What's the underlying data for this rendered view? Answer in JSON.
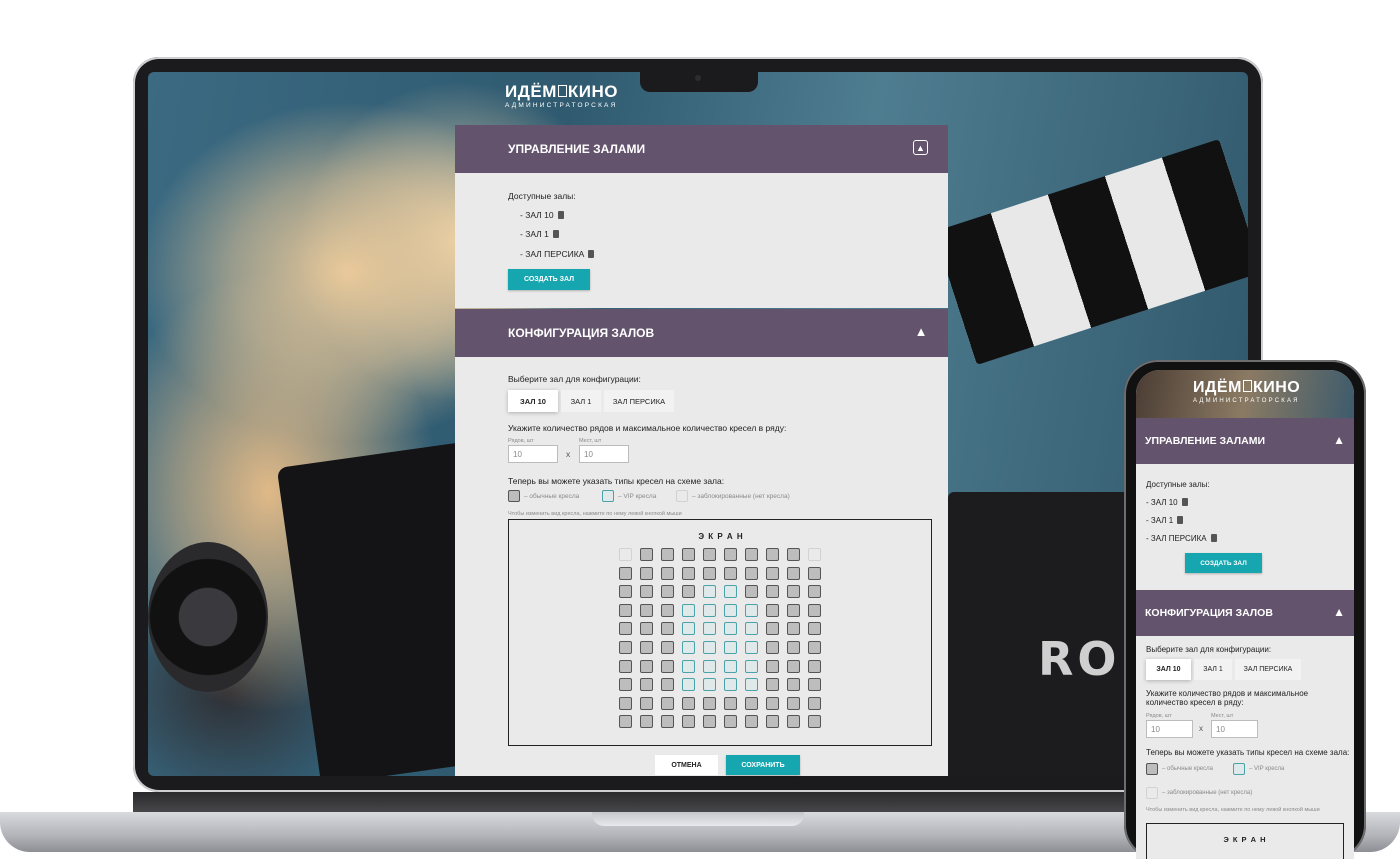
{
  "brand": {
    "title_left": "ИДЁМ",
    "title_right": "КИНО",
    "subtitle": "АДМИНИСТРАТОРСКАЯ"
  },
  "halls_panel": {
    "title": "Управление залами",
    "available_label": "Доступные залы:",
    "halls": [
      "- ЗАЛ 10",
      "- ЗАЛ 1",
      "- ЗАЛ ПЕРСИКА"
    ],
    "create_button": "СОЗДАТЬ ЗАЛ"
  },
  "config_panel": {
    "title": "Конфигурация залов",
    "select_label": "Выберите зал для конфигурации:",
    "tabs": [
      "ЗАЛ 10",
      "ЗАЛ 1",
      "ЗАЛ ПЕРСИКА"
    ],
    "active_tab": "ЗАЛ 10",
    "rows_prompt": "Укажите количество рядов и максимальное количество кресел в ряду:",
    "rows_label": "Рядов, шт",
    "rows_value": "10",
    "seats_label": "Мест, шт",
    "seats_value": "10",
    "times": "x",
    "types_prompt": "Теперь вы можете указать типы кресел на схеме зала:",
    "legend": {
      "regular": "– обычные кресла",
      "vip": "– VIP кресла",
      "blocked": "– заблокированные (нет кресла)"
    },
    "hint": "Чтобы изменить вид кресла, нажмите по нему левой кнопкой мыши",
    "screen_label": "Э К Р А Н",
    "seat_map": [
      [
        "blocked",
        "regular",
        "regular",
        "regular",
        "regular",
        "regular",
        "regular",
        "regular",
        "regular",
        "blocked"
      ],
      [
        "regular",
        "regular",
        "regular",
        "regular",
        "regular",
        "regular",
        "regular",
        "regular",
        "regular",
        "regular"
      ],
      [
        "regular",
        "regular",
        "regular",
        "regular",
        "vip",
        "vip",
        "regular",
        "regular",
        "regular",
        "regular"
      ],
      [
        "regular",
        "regular",
        "regular",
        "vip",
        "vip",
        "vip",
        "vip",
        "regular",
        "regular",
        "regular"
      ],
      [
        "regular",
        "regular",
        "regular",
        "vip",
        "vip",
        "vip",
        "vip",
        "regular",
        "regular",
        "regular"
      ],
      [
        "regular",
        "regular",
        "regular",
        "vip",
        "vip",
        "vip",
        "vip",
        "regular",
        "regular",
        "regular"
      ],
      [
        "regular",
        "regular",
        "regular",
        "vip",
        "vip",
        "vip",
        "vip",
        "regular",
        "regular",
        "regular"
      ],
      [
        "regular",
        "regular",
        "regular",
        "vip",
        "vip",
        "vip",
        "vip",
        "regular",
        "regular",
        "regular"
      ],
      [
        "regular",
        "regular",
        "regular",
        "regular",
        "regular",
        "regular",
        "regular",
        "regular",
        "regular",
        "regular"
      ],
      [
        "regular",
        "regular",
        "regular",
        "regular",
        "regular",
        "regular",
        "regular",
        "regular",
        "regular",
        "regular"
      ]
    ],
    "cancel_button": "ОТМЕНА",
    "save_button": "СОХРАНИТЬ"
  },
  "background": {
    "clapper_text": "RO"
  },
  "colors": {
    "header": "#63536c",
    "accent": "#16a6af",
    "panel_bg": "#eaeaea"
  }
}
